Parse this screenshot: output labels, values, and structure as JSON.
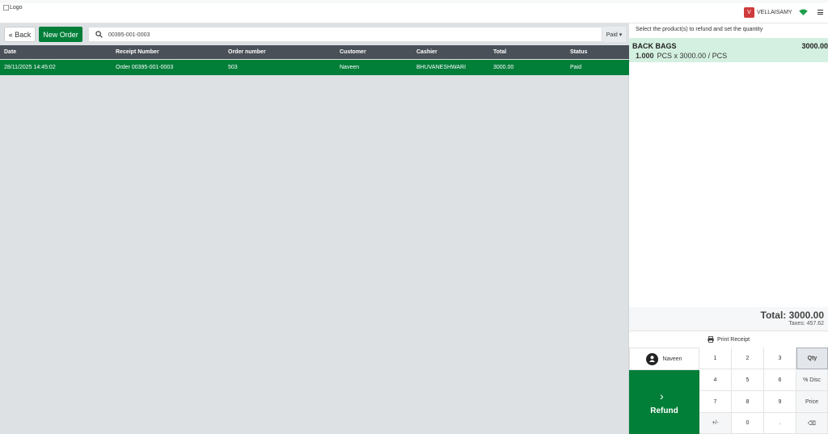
{
  "header": {
    "logo_alt": "Logo",
    "user_initial": "V",
    "user_name": "VELLAISAMY"
  },
  "controls": {
    "back_label": "« Back",
    "new_order_label": "New Order",
    "search_value": "00395-001-0003",
    "filter_label": "Paid ▾"
  },
  "table": {
    "columns": [
      "Date",
      "Receipt Number",
      "Order number",
      "Customer",
      "Cashier",
      "Total",
      "Status"
    ],
    "rows": [
      [
        "28/11/2025 14:45:02",
        "Order 00395-001-0003",
        "503",
        "Naveen",
        "BHUVANESHWARI",
        "3000.00",
        "Paid"
      ]
    ]
  },
  "refund": {
    "hint": "Select the product(s) to refund and set the quantity",
    "line": {
      "product": "BACK BAGS",
      "price": "3000.00",
      "qty": "1.000",
      "detail": "PCS x 3000.00 / PCS"
    },
    "total": "Total: 3000.00",
    "taxes": "Taxes: 457.62",
    "print_label": "Print Receipt",
    "customer": "Naveen",
    "refund_label": "Refund"
  },
  "numpad": {
    "rows": [
      [
        "1",
        "2",
        "3",
        "Qty"
      ],
      [
        "4",
        "5",
        "6",
        "% Disc"
      ],
      [
        "7",
        "8",
        "9",
        "Price"
      ],
      [
        "+/-",
        "0",
        ".",
        "⌫"
      ]
    ],
    "active_mode": "Qty"
  },
  "colors": {
    "brand_green": "#017e38",
    "table_header": "#495057",
    "selected_line": "#d4f0e0"
  }
}
